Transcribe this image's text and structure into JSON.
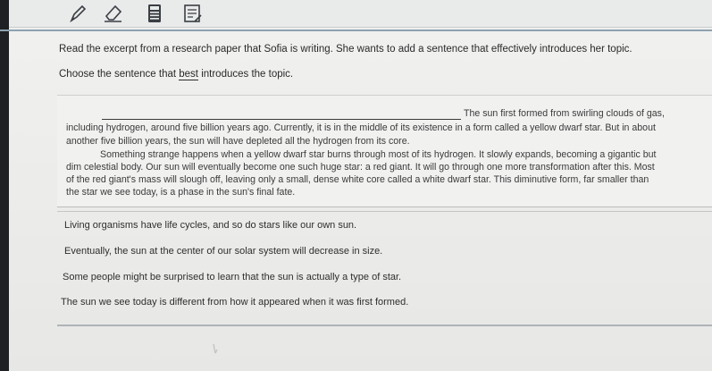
{
  "toolbar": {
    "tools": [
      {
        "icon": "pencil-icon"
      },
      {
        "icon": "eraser-icon"
      },
      {
        "icon": "calculator-icon"
      },
      {
        "icon": "reference-sheet-icon"
      }
    ]
  },
  "prompt": {
    "instruction": "Read the excerpt from a research paper that Sofia is writing. She wants to add a sentence that effectively introduces her topic.",
    "question_before": "Choose the sentence that ",
    "question_emphasis": "best",
    "question_after": " introduces the topic."
  },
  "passage": {
    "lines": [
      "The sun first formed from swirling clouds of gas,",
      "including hydrogen, around five billion years ago. Currently, it is in the middle of its existence in a form called a yellow dwarf star. But in about",
      "another five billion years, the sun will have depleted all the hydrogen from its core.",
      "Something strange happens when a yellow dwarf star burns through most of its hydrogen. It slowly expands, becoming a gigantic but",
      "dim celestial body. Our sun will eventually become one such huge star: a red giant. It will go through one more transformation after this. Most",
      "of the red giant's mass will slough off, leaving only a small, dense white core called a white dwarf star. This diminutive form, far smaller than",
      "the star we see today, is a phase in the sun's final fate."
    ]
  },
  "choices": [
    {
      "text": "Living organisms have life cycles, and so do stars like our own sun."
    },
    {
      "text": "Eventually, the sun at the center of our solar system will decrease in size."
    },
    {
      "text": "Some people might be surprised to learn that the sun is actually a type of star."
    },
    {
      "text": "The sun we see today is different from how it appeared when it was first formed."
    }
  ]
}
